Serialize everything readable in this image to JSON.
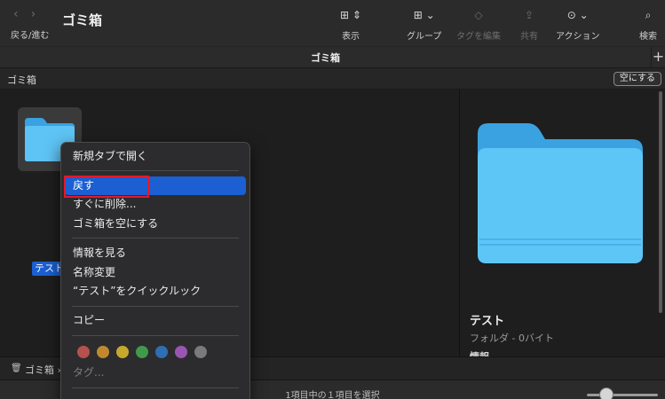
{
  "toolbar": {
    "nav_label": "戻る/進む",
    "title": "ゴミ箱",
    "items": [
      {
        "label": "表示",
        "icon": "⊞ ⇕"
      },
      {
        "label": "グループ",
        "icon": "⊞ ⌄"
      },
      {
        "label": "タグを編集",
        "icon": "◇"
      },
      {
        "label": "共有",
        "icon": "⇪"
      },
      {
        "label": "アクション",
        "icon": "⊙ ⌄"
      },
      {
        "label": "検索",
        "icon": "⌕"
      }
    ]
  },
  "tabbar": {
    "title": "ゴミ箱",
    "plus": "+"
  },
  "path_header": {
    "label": "ゴミ箱",
    "empty_button": "空にする"
  },
  "file": {
    "name": "テスト"
  },
  "context_menu": {
    "items": [
      "新規タブで開く",
      "戻す",
      "すぐに削除...",
      "ゴミ箱を空にする",
      "情報を見る",
      "名称変更",
      "“テスト”をクイックルック",
      "コピー",
      "タグ..."
    ],
    "tag_colors": [
      "#b5524e",
      "#c0892e",
      "#c4a92d",
      "#3f9a4c",
      "#2f6eb3",
      "#9a55b3",
      "#7a7a7a"
    ]
  },
  "preview": {
    "name": "テスト",
    "meta": "フォルダ - 0バイト",
    "info": "情報"
  },
  "path_bar": {
    "label": "ゴミ箱 ›"
  },
  "status": {
    "text": "1項目中の１項目を選択"
  },
  "colors": {
    "accent": "#1b5fd3",
    "folder": "#55bdf2",
    "highlight_box": "#e3192b"
  }
}
